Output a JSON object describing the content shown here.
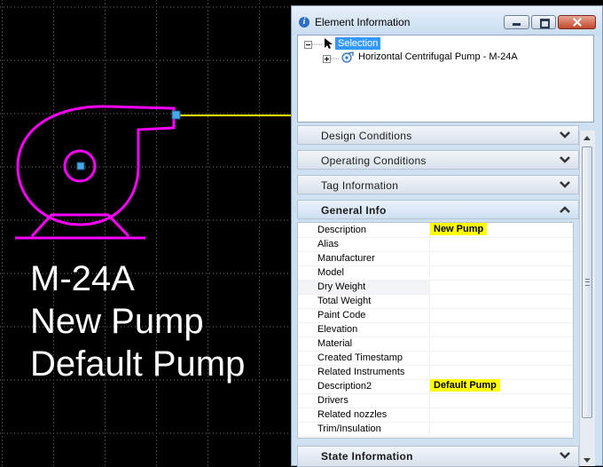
{
  "drawing": {
    "labels": [
      "M-24A",
      "New Pump",
      "Default Pump"
    ],
    "colors": {
      "pump": "#ff00ff",
      "line": "#ffff00",
      "grid": "#7a7a7a",
      "connector": "#4aa8e8"
    }
  },
  "panel": {
    "title": "Element Information",
    "tree": {
      "root_label": "Selection",
      "child_label": "Horizontal Centrifugal Pump - M-24A",
      "icons": [
        "cursor-icon",
        "pump-icon"
      ]
    },
    "sections": {
      "design": "Design Conditions",
      "operating": "Operating Conditions",
      "tag": "Tag Information",
      "general": "General Info",
      "state": "State Information"
    },
    "properties": [
      {
        "name": "Description",
        "value": "New Pump"
      },
      {
        "name": "Alias",
        "value": ""
      },
      {
        "name": "Manufacturer",
        "value": ""
      },
      {
        "name": "Model",
        "value": ""
      },
      {
        "name": "Dry Weight",
        "value": ""
      },
      {
        "name": "Total Weight",
        "value": ""
      },
      {
        "name": "Paint Code",
        "value": ""
      },
      {
        "name": "Elevation",
        "value": ""
      },
      {
        "name": "Material",
        "value": ""
      },
      {
        "name": "Created Timestamp",
        "value": ""
      },
      {
        "name": "Related Instruments",
        "value": ""
      },
      {
        "name": "Description2",
        "value": "Default Pump"
      },
      {
        "name": "Drivers",
        "value": ""
      },
      {
        "name": "Related nozzles",
        "value": ""
      },
      {
        "name": "Trim/Insulation",
        "value": ""
      }
    ],
    "highlight_color": "#ffff00"
  }
}
